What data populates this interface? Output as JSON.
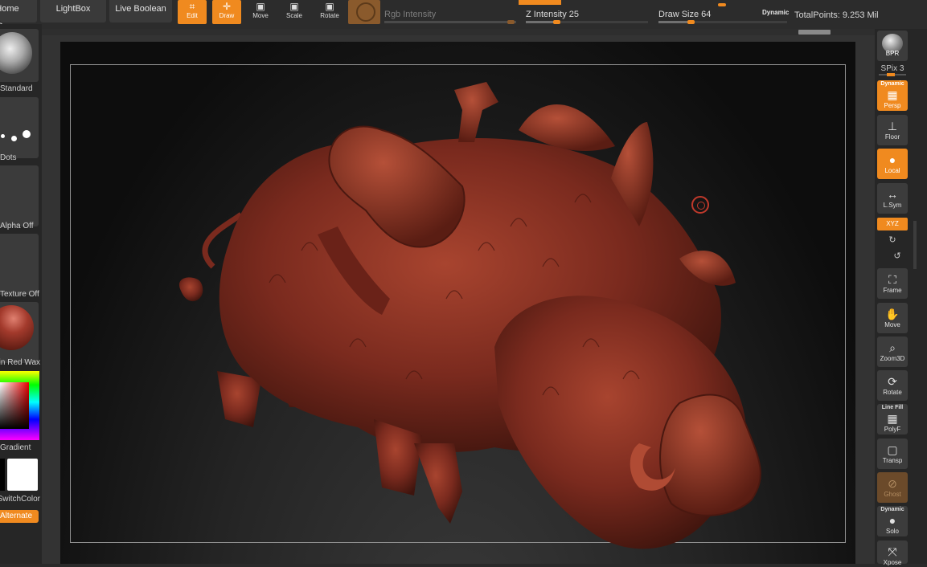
{
  "menu": {
    "home_page": "Home Page",
    "lightbox": "LightBox",
    "live_boolean": "Live Boolean"
  },
  "tools": {
    "edit": "Edit",
    "draw": "Draw",
    "move": "Move",
    "scale": "Scale",
    "rotate": "Rotate"
  },
  "sliders": {
    "rgb_intensity": "Rgb Intensity",
    "z_intensity": "Z Intensity 25",
    "z_intensity_value": 25,
    "draw_size": "Draw Size 64",
    "draw_size_value": 64,
    "dynamic": "Dynamic"
  },
  "status": {
    "total_points": "TotalPoints: 9.253 Mil"
  },
  "left_tray": {
    "brush_label": "Standard",
    "stroke_label": "Dots",
    "alpha_label": "Alpha Off",
    "texture_label": "Texture Off",
    "material_label": "Skin Red Wax",
    "gradient_label": "Gradient",
    "color_label": "SwitchColor",
    "alternate_label": "Alternate"
  },
  "right_shelf": {
    "bpr": "BPR",
    "spix": "SPix 3",
    "dynamic": "Dynamic",
    "persp": "Persp",
    "floor": "Floor",
    "local": "Local",
    "lsym": "L.Sym",
    "xyz": "XYZ",
    "frame": "Frame",
    "move": "Move",
    "zoom3d": "Zoom3D",
    "rotate": "Rotate",
    "line_fill": "Line Fill",
    "polyf": "PolyF",
    "transp": "Transp",
    "ghost": "Ghost",
    "dynamic2": "Dynamic",
    "solo": "Solo",
    "xpose": "Xpose"
  },
  "colors": {
    "accent": "#f08a1f",
    "material": "#7a2a1e",
    "background": "#2a2a2a"
  }
}
